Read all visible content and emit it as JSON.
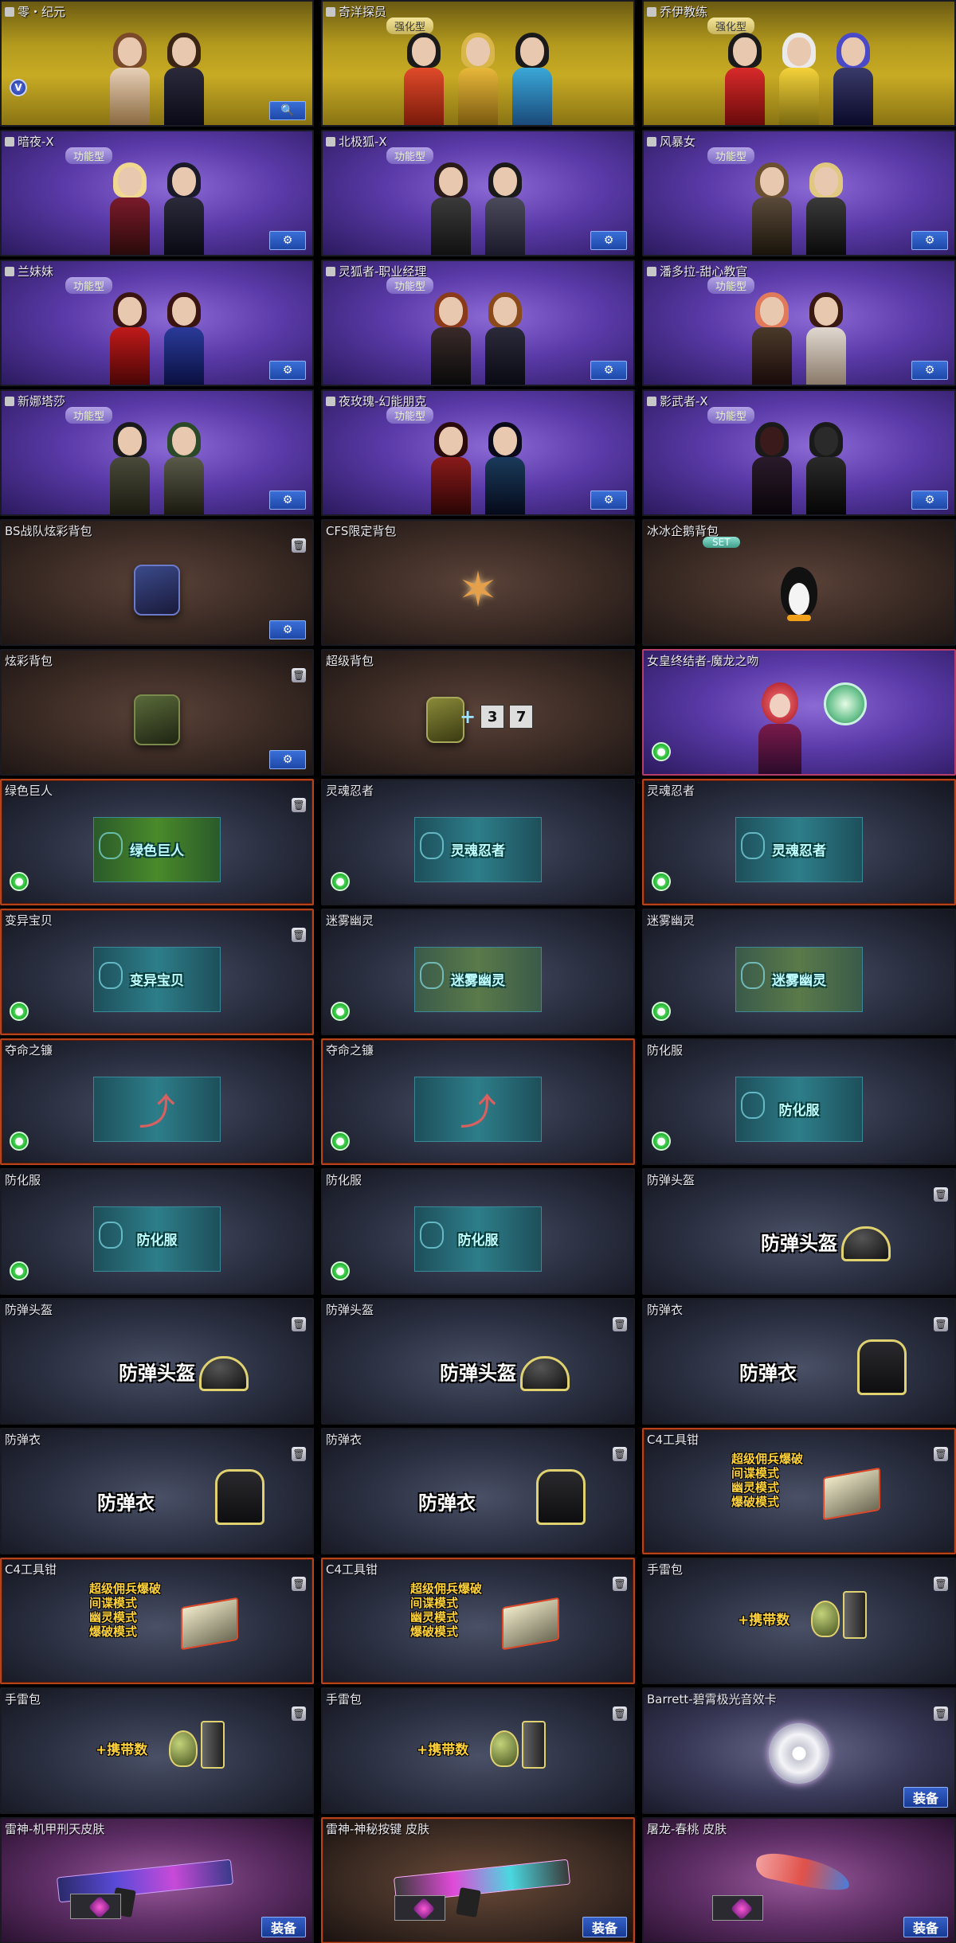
{
  "cards": [
    {
      "title": "零・纪元",
      "badge": "",
      "bg": "gold"
    },
    {
      "title": "奇洋探员",
      "badge": "强化型",
      "bg": "gold"
    },
    {
      "title": "乔伊教练",
      "badge": "强化型",
      "bg": "gold"
    },
    {
      "title": "暗夜-X",
      "badge": "功能型",
      "bg": "purple"
    },
    {
      "title": "北极狐-X",
      "badge": "功能型",
      "bg": "purple"
    },
    {
      "title": "风暴女",
      "badge": "功能型",
      "bg": "purple"
    },
    {
      "title": "兰妹妹",
      "badge": "功能型",
      "bg": "purple"
    },
    {
      "title": "灵狐者-职业经理",
      "badge": "功能型",
      "bg": "purple"
    },
    {
      "title": "潘多拉-甜心教官",
      "badge": "功能型",
      "bg": "purple"
    },
    {
      "title": "新娜塔莎",
      "badge": "功能型",
      "bg": "purple"
    },
    {
      "title": "夜玫瑰-幻能朋克",
      "badge": "功能型",
      "bg": "purple"
    },
    {
      "title": "影武者-X",
      "badge": "功能型",
      "bg": "purple"
    },
    {
      "title": "BS战队炫彩背包",
      "bg": "brown"
    },
    {
      "title": "CFS限定背包",
      "bg": "brown"
    },
    {
      "title": "冰冰企鹅背包",
      "badge": "SET",
      "bg": "brown"
    },
    {
      "title": "炫彩背包",
      "bg": "brown"
    },
    {
      "title": "超级背包",
      "bg": "brown"
    },
    {
      "title": "女皇终结者-魔龙之吻",
      "bg": "purple"
    },
    {
      "title": "绿色巨人",
      "item_label": "绿色巨人"
    },
    {
      "title": "灵魂忍者",
      "item_label": "灵魂忍者"
    },
    {
      "title": "灵魂忍者",
      "item_label": "灵魂忍者"
    },
    {
      "title": "变异宝贝",
      "item_label": "变异宝贝"
    },
    {
      "title": "迷雾幽灵",
      "item_label": "迷雾幽灵"
    },
    {
      "title": "迷雾幽灵",
      "item_label": "迷雾幽灵"
    },
    {
      "title": "夺命之镰",
      "item_label": ""
    },
    {
      "title": "夺命之镰",
      "item_label": ""
    },
    {
      "title": "防化服",
      "item_label": "防化服"
    },
    {
      "title": "防化服",
      "item_label": "防化服"
    },
    {
      "title": "防化服",
      "item_label": "防化服"
    },
    {
      "title": "防弹头盔",
      "item_label": "防弹头盔"
    },
    {
      "title": "防弹头盔",
      "item_label": "防弹头盔"
    },
    {
      "title": "防弹头盔",
      "item_label": "防弹头盔"
    },
    {
      "title": "防弹衣",
      "item_label": "防弹衣"
    },
    {
      "title": "防弹衣",
      "item_label": "防弹衣"
    },
    {
      "title": "防弹衣",
      "item_label": "防弹衣"
    },
    {
      "title": "C4工具钳"
    },
    {
      "title": "C4工具钳"
    },
    {
      "title": "C4工具钳"
    },
    {
      "title": "手雷包"
    },
    {
      "title": "手雷包"
    },
    {
      "title": "手雷包"
    },
    {
      "title": "Barrett-碧霄极光音效卡",
      "button": "装备"
    },
    {
      "title": "雷神-机甲刑天皮肤",
      "button": "装备"
    },
    {
      "title": "雷神-神秘按键 皮肤",
      "button": "装备"
    },
    {
      "title": "屠龙-春桃 皮肤",
      "button": "装备"
    }
  ],
  "c4_modes": [
    "超级佣兵爆破",
    "间谍模式",
    "幽灵模式",
    "爆破模式"
  ],
  "grenade_label": "+携带数",
  "bag_nums": {
    "a": "3",
    "b": "7",
    "tag": "BAG"
  },
  "icons": {
    "search": "search-icon",
    "gear": "gear-icon",
    "trash": "trash-icon",
    "mode": "green-mode-icon",
    "vip": "vip-icon"
  },
  "colors": {
    "gold": "#c8ab24",
    "purple": "#5a3aa8",
    "brown": "#3a2a24",
    "navy": "#2b3042",
    "accent_button": "#1e48a8",
    "red_border": "#b5431c"
  }
}
